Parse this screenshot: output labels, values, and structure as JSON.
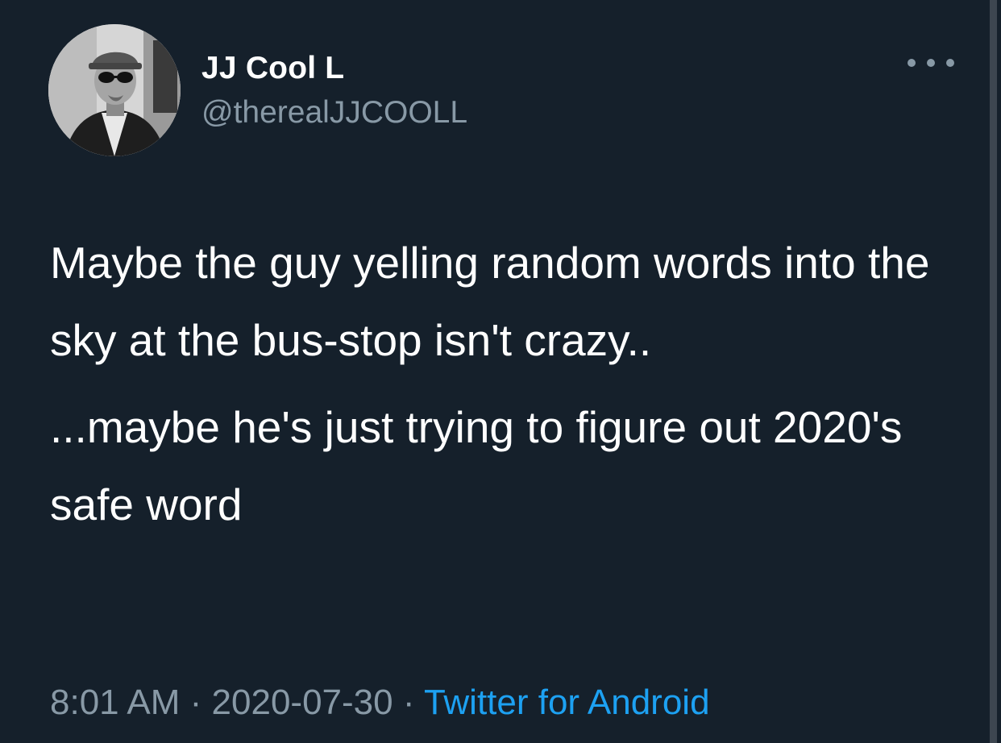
{
  "tweet": {
    "display_name": "JJ Cool L",
    "handle": "@therealJJCOOLL",
    "text_paragraph_1": "Maybe the guy yelling random words into the sky at the bus-stop isn't crazy..",
    "text_paragraph_2": "...maybe he's just trying to figure out 2020's safe word",
    "time": "8:01 AM",
    "separator": " · ",
    "date": "2020-07-30",
    "source": "Twitter for Android"
  },
  "icons": {
    "more": "more-horizontal-icon",
    "avatar": "profile-photo"
  },
  "colors": {
    "background": "#15202b",
    "primary_text": "#ffffff",
    "secondary_text": "#8899a6",
    "link": "#1da1f2"
  }
}
